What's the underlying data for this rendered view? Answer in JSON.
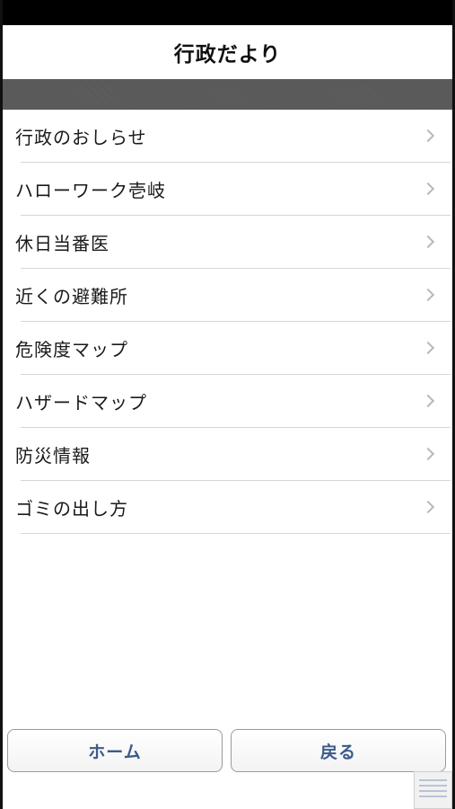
{
  "nav": {
    "title": "行政だより"
  },
  "menu": {
    "items": [
      {
        "label": "行政のおしらせ"
      },
      {
        "label": "ハローワーク壱岐"
      },
      {
        "label": "休日当番医"
      },
      {
        "label": "近くの避難所"
      },
      {
        "label": "危険度マップ"
      },
      {
        "label": "ハザードマップ"
      },
      {
        "label": "防災情報"
      },
      {
        "label": "ゴミの出し方"
      }
    ]
  },
  "toolbar": {
    "home_label": "ホーム",
    "back_label": "戻る"
  },
  "icons": {
    "row_disclosure": "chevron-right-icon"
  },
  "colors": {
    "button_text": "#3c5a8a",
    "section_band": "#5a5a5a",
    "status_bar": "#000000"
  }
}
